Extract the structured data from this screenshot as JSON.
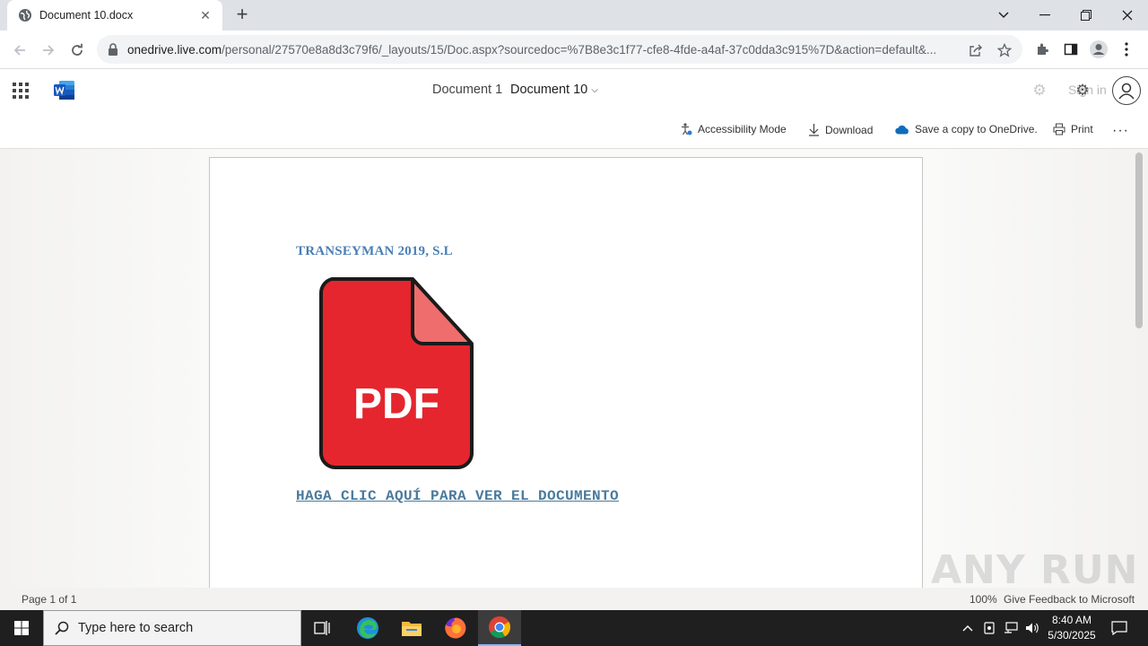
{
  "browser": {
    "tab_title": "Document 10.docx",
    "url_host": "onedrive.live.com",
    "url_path": "/personal/27570e8a8d3c79f6/_layouts/15/Doc.aspx?sourcedoc=%7B8e3c1f77-cfe8-4fde-a4af-37c0dda3c915%7D&action=default&..."
  },
  "word": {
    "breadcrumb_doc": "Document 1",
    "doc_name": "Document 10",
    "signin_label": "Sign in"
  },
  "ribbon": {
    "accessibility": "Accessibility Mode",
    "download": "Download",
    "save_copy": "Save a copy to OneDrive.",
    "print": "Print"
  },
  "document": {
    "company": "TRANSEYMAN 2019, S.L",
    "pdf_label": "PDF",
    "link_text": "HAGA CLIC AQUÍ PARA VER EL DOCUMENTO"
  },
  "status": {
    "page": "Page 1 of 1",
    "zoom": "100%",
    "feedback": "Give Feedback to Microsoft"
  },
  "watermark": "ANY RUN",
  "taskbar": {
    "search_placeholder": "Type here to search",
    "time": "8:40 AM",
    "date": "5/30/2025"
  },
  "colors": {
    "pdf_red": "#e5262e",
    "company_blue": "#4a7eb5",
    "link_blue": "#4a7a9c"
  }
}
